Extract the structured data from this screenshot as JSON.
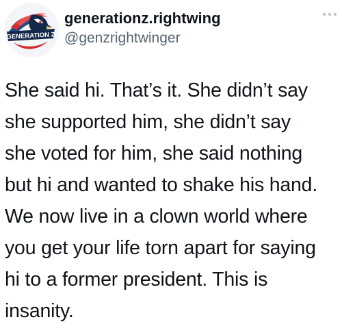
{
  "tweet": {
    "author": {
      "display_name": "generationz.rightwing",
      "handle": "@genzrightwinger",
      "avatar_logo_text": "GENERATION Z",
      "avatar_icon": "eagle-logo-icon"
    },
    "more_icon": "more-horizontal-icon",
    "text_lines": [
      "She said hi. That’s it. She didn’t say",
      "she supported him, she didn’t say",
      "she voted for him, she said nothing",
      "but hi and wanted to shake his hand.",
      "We now live in a clown world where",
      "you get your life torn apart for saying",
      "hi to a former president. This is",
      "insanity."
    ]
  },
  "colors": {
    "text": "#0f1419",
    "handle": "#536471",
    "avatar_red": "#d62b2b",
    "avatar_blue": "#1a4c8c",
    "avatar_navy": "#14284a"
  }
}
